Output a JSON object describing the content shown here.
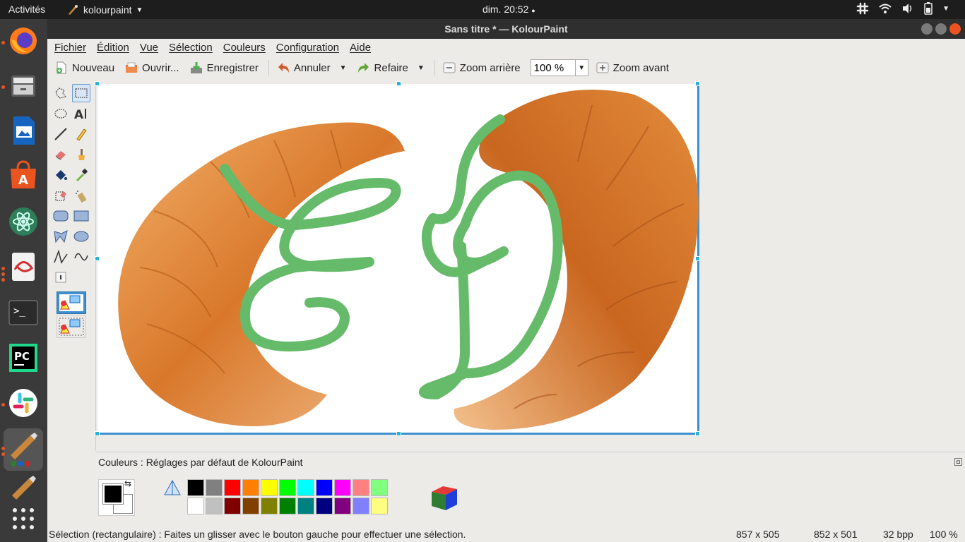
{
  "topbar": {
    "activities": "Activités",
    "app_name": "kolourpaint",
    "clock": "dim. 20:52"
  },
  "dock": {
    "items": [
      "firefox-icon",
      "files-icon",
      "writer-icon",
      "software-icon",
      "atom-icon",
      "pdf-icon",
      "terminal-icon",
      "pycharm-icon",
      "slack-icon",
      "kolourpaint-icon",
      "kolourpaint-icon-2",
      "apps-grid-icon"
    ]
  },
  "window": {
    "title": "Sans titre * — KolourPaint"
  },
  "menu": {
    "items": [
      "Fichier",
      "Édition",
      "Vue",
      "Sélection",
      "Couleurs",
      "Configuration",
      "Aide"
    ]
  },
  "toolbar": {
    "new": "Nouveau",
    "open": "Ouvrir...",
    "save": "Enregistrer",
    "undo": "Annuler",
    "redo": "Refaire",
    "zoom_out": "Zoom arrière",
    "zoom_value": "100 %",
    "zoom_in": "Zoom avant"
  },
  "colorbox": {
    "label": "Couleurs : Réglages par défaut de KolourPaint",
    "foreground": "#000000",
    "background": "#ffffff",
    "palette_top": [
      "#000000",
      "#808080",
      "#ff0000",
      "#ff8000",
      "#ffff00",
      "#00ff00",
      "#00ffff",
      "#0000ff",
      "#ff00ff",
      "#ff8080",
      "#80ff80"
    ],
    "palette_bottom": [
      "#ffffff",
      "#c0c0c0",
      "#800000",
      "#804000",
      "#808000",
      "#008000",
      "#008080",
      "#000080",
      "#800080",
      "#8080ff",
      "#ffff80"
    ]
  },
  "status": {
    "message": "Sélection (rectangulaire) : Faites un glisser avec le bouton gauche pour effectuer une sélection.",
    "cursor": "857 x 505",
    "size": "852 x 501",
    "depth": "32 bpp",
    "zoom": "100 %"
  },
  "colors": {
    "stroke": "#66bb6a",
    "accent": "#e95420",
    "selection": "#3d8fd0"
  }
}
